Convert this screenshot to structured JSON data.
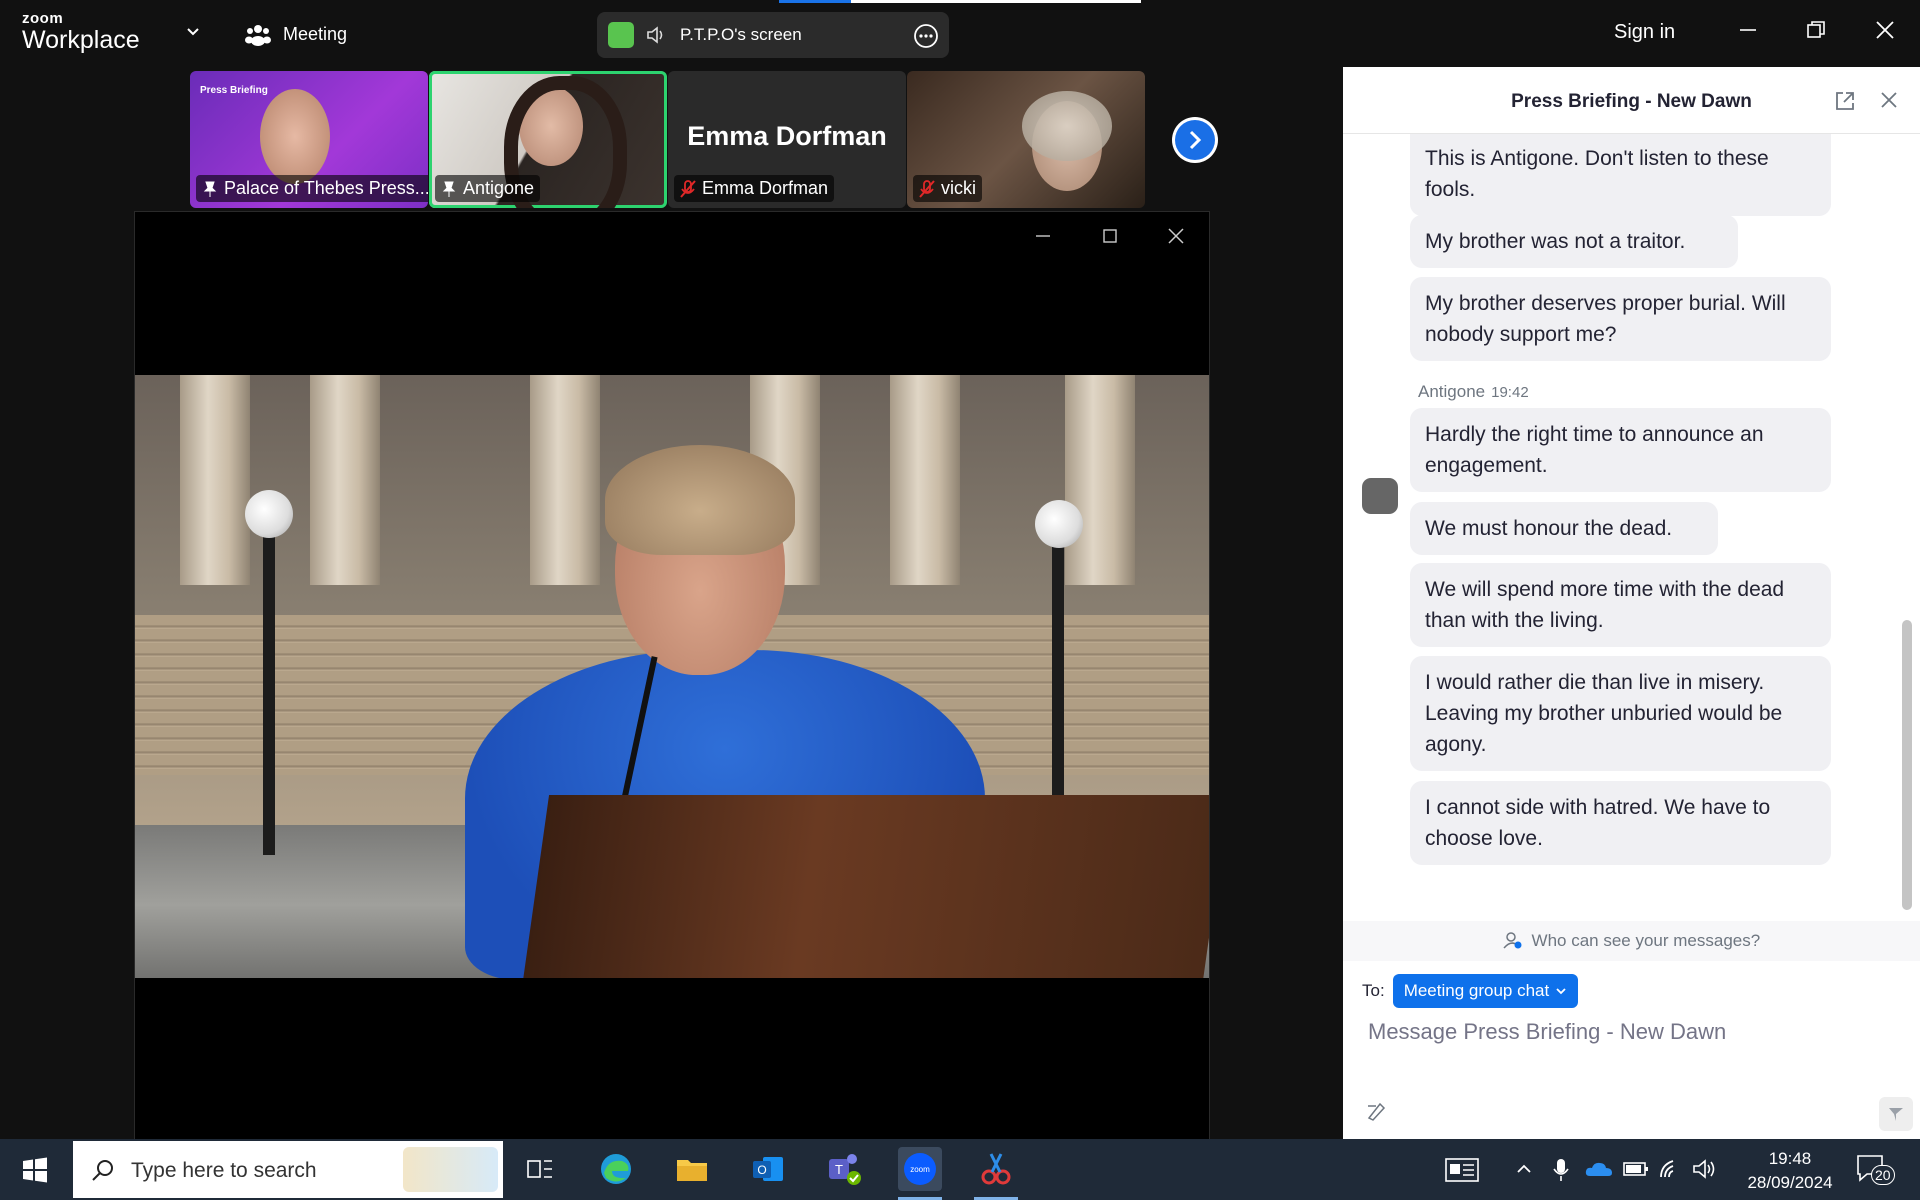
{
  "app": {
    "brand_small": "zoom",
    "brand_large": "Workplace",
    "meeting_label": "Meeting",
    "sign_in": "Sign in"
  },
  "share": {
    "label": "P.T.P.O's screen"
  },
  "thumbnails": [
    {
      "name": "Palace of Thebes Press...",
      "overlay": "Press Briefing",
      "icon": "pin-icon"
    },
    {
      "name": "Antigone",
      "icon": "pin-icon"
    },
    {
      "name": "Emma Dorfman",
      "big_name": "Emma Dorfman",
      "icon": "mic-muted-icon"
    },
    {
      "name": "vicki",
      "icon": "mic-muted-icon"
    }
  ],
  "chat": {
    "title": "Press Briefing - New Dawn",
    "messages": [
      {
        "text": "This is Antigone. Don't listen to these fools."
      },
      {
        "text": "My brother was not a traitor."
      },
      {
        "text": "My brother deserves proper burial. Will nobody support me?"
      },
      {
        "sender": "Antigone",
        "time": "19:42",
        "text": "Hardly the right time to announce an engagement."
      },
      {
        "text": "We must honour the dead."
      },
      {
        "text": "We will spend more time with the dead than with the living."
      },
      {
        "text": "I would rather die than live in misery. Leaving my brother unburied would be agony."
      },
      {
        "text": "I cannot side with hatred. We have to choose love."
      }
    ],
    "who_can_see": "Who can see your messages?",
    "to_label": "To:",
    "recipient": "Meeting group chat",
    "compose_placeholder": "Message Press Briefing - New Dawn"
  },
  "taskbar": {
    "search_placeholder": "Type here to search",
    "time": "19:48",
    "date": "28/09/2024",
    "notification_count": "20"
  },
  "colors": {
    "accent": "#0e71eb",
    "active_speaker": "#2dd36f",
    "share_green": "#59c44f",
    "taskbar": "#1f2a38"
  }
}
